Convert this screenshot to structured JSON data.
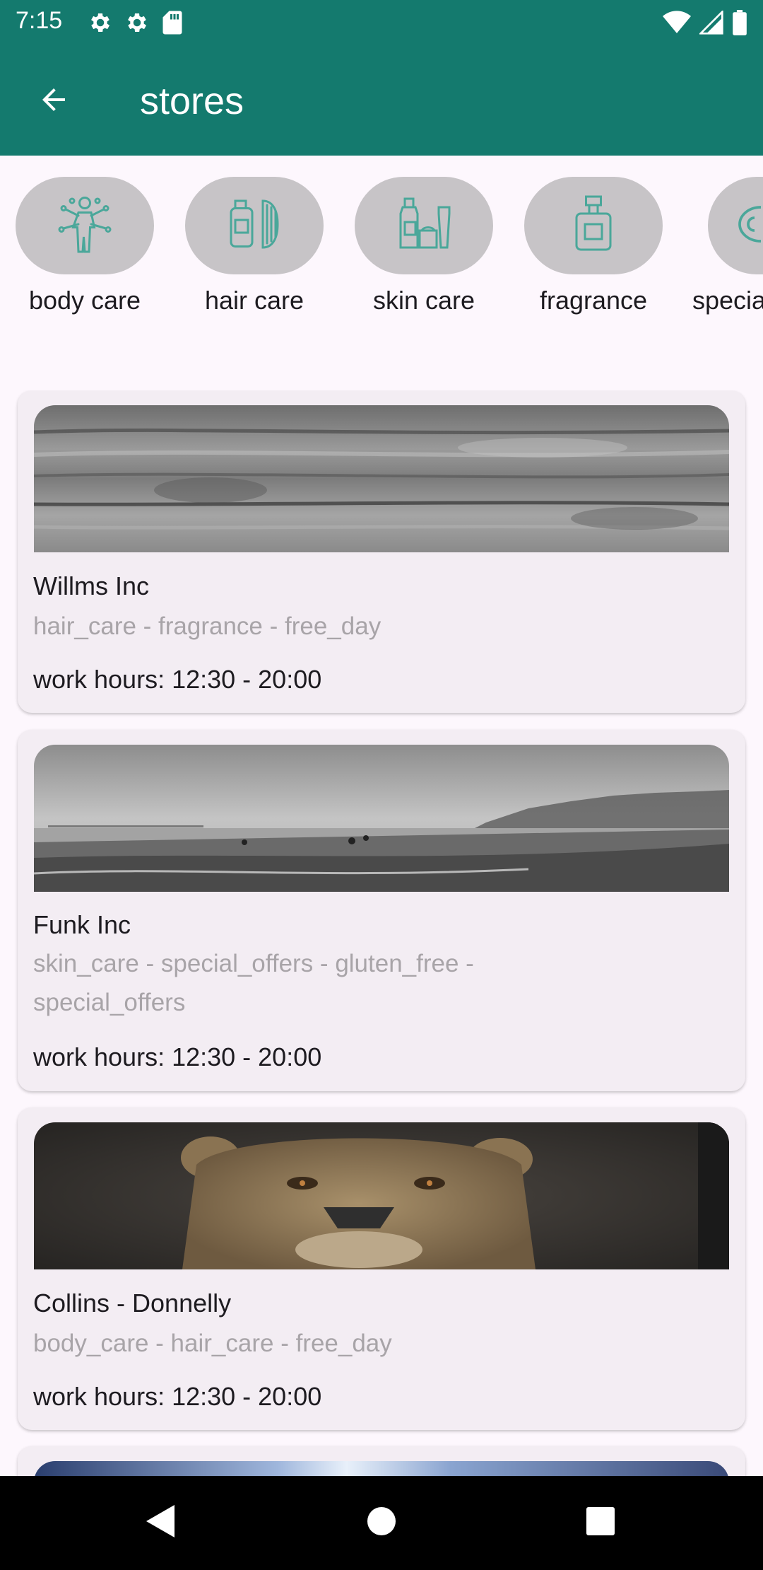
{
  "status_bar": {
    "time": "7:15",
    "left_icons": [
      "settings-icon",
      "settings-icon",
      "sd-card-icon"
    ],
    "right_icons": [
      "wifi-icon",
      "signal-icon",
      "battery-icon"
    ]
  },
  "app_bar": {
    "title": "stores",
    "back_icon": "arrow-back-icon",
    "background": "#147a6e"
  },
  "categories": [
    {
      "label": "body care",
      "icon": "body-care-icon"
    },
    {
      "label": "hair care",
      "icon": "hair-care-icon"
    },
    {
      "label": "skin care",
      "icon": "skin-care-icon"
    },
    {
      "label": "fragrance",
      "icon": "fragrance-icon"
    },
    {
      "label": "specia",
      "icon": "special-offers-icon"
    }
  ],
  "stores": [
    {
      "name": "Willms Inc",
      "tags": "hair_care  - fragrance  - free_day",
      "hours": "work hours: 12:30  - 20:00",
      "image": "wood-texture"
    },
    {
      "name": "Funk Inc",
      "tags": "skin_care  - special_offers  - gluten_free  - special_offers",
      "hours": "work hours: 12:30  - 20:00",
      "image": "beach"
    },
    {
      "name": "Collins - Donnelly",
      "tags": "body_care  - hair_care  - free_day",
      "hours": "work hours: 12:30  - 20:00",
      "image": "lioness"
    },
    {
      "name": "",
      "tags": "",
      "hours": "",
      "image": "blue-sky"
    }
  ],
  "nav_bar": {
    "back_icon": "nav-back-icon",
    "home_icon": "nav-home-icon",
    "recents_icon": "nav-recents-icon"
  },
  "colors": {
    "primary": "#147a6e",
    "icon_teal": "#4aa79a",
    "chip_bg": "#c7c4c7",
    "card_bg": "#f3edf3",
    "tag_text": "#a8a4a8"
  }
}
